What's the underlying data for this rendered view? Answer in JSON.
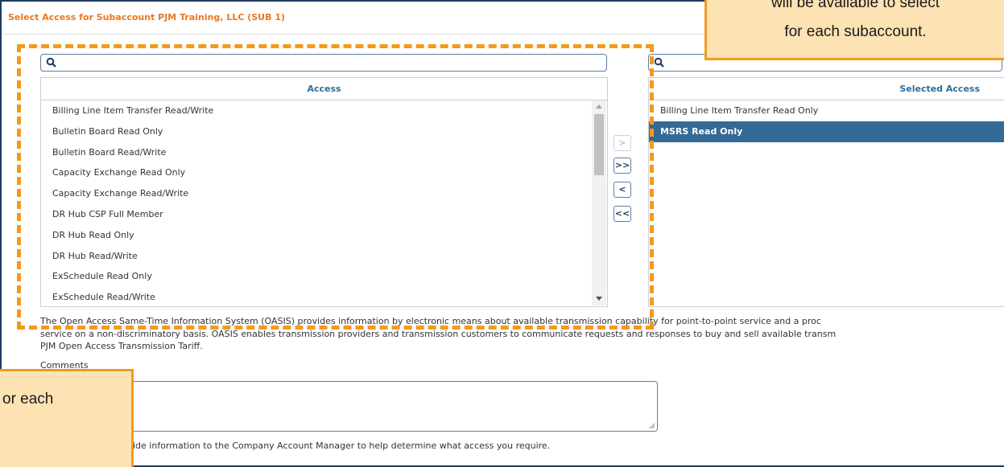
{
  "panel": {
    "title": "Select Access for Subaccount PJM Training, LLC (SUB 1)"
  },
  "search": {
    "left_placeholder": "",
    "right_placeholder": "",
    "icon": "search-icon"
  },
  "access_list": {
    "header": "Access",
    "items": [
      "Billing Line Item Transfer Read/Write",
      "Bulletin Board Read Only",
      "Bulletin Board Read/Write",
      "Capacity Exchange Read Only",
      "Capacity Exchange Read/Write",
      "DR Hub CSP Full Member",
      "DR Hub Read Only",
      "DR Hub Read/Write",
      "ExSchedule Read Only",
      "ExSchedule Read/Write"
    ]
  },
  "selected_list": {
    "header": "Selected Access",
    "items": [
      {
        "label": "Billing Line Item Transfer Read Only",
        "selected": false
      },
      {
        "label": "MSRS Read Only",
        "selected": true
      }
    ]
  },
  "transfer_buttons": {
    "move_right": ">",
    "move_all_right": ">>",
    "move_left": "<",
    "move_all_left": "<<"
  },
  "description": {
    "line1": "The Open Access Same-Time Information System (OASIS) provides information by electronic means about available transmission capability for point-to-point service and a proc",
    "line2": "service on a non-discriminatory basis. OASIS enables transmission providers and transmission customers to communicate requests and responses to buy and sell available transm",
    "line3": "PJM Open Access Transmission Tariff."
  },
  "comments": {
    "label": "Comments",
    "value": "",
    "hint": "mments field to provide information to the Company Account Manager to help determine what access you require."
  },
  "callouts": {
    "top_line1": "will be available to select",
    "top_line2": "for each subaccount.",
    "bottom_line1": "or each"
  },
  "colors": {
    "title_orange": "#e87722",
    "header_blue": "#2d6e9e",
    "selected_bg": "#336a96",
    "callout_fill": "#fde2b4",
    "callout_border": "#f29a1e",
    "panel_border": "#1f3a5c"
  }
}
